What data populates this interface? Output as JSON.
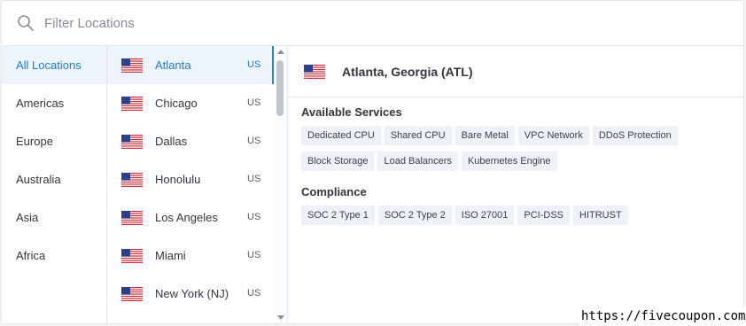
{
  "search": {
    "placeholder": "Filter Locations",
    "value": ""
  },
  "regions": [
    {
      "label": "All Locations",
      "active": true
    },
    {
      "label": "Americas"
    },
    {
      "label": "Europe"
    },
    {
      "label": "Australia"
    },
    {
      "label": "Asia"
    },
    {
      "label": "Africa"
    }
  ],
  "cities": [
    {
      "name": "Atlanta",
      "country": "US",
      "flag": "us-flag-icon",
      "active": true
    },
    {
      "name": "Chicago",
      "country": "US",
      "flag": "us-flag-icon"
    },
    {
      "name": "Dallas",
      "country": "US",
      "flag": "us-flag-icon"
    },
    {
      "name": "Honolulu",
      "country": "US",
      "flag": "us-flag-icon"
    },
    {
      "name": "Los Angeles",
      "country": "US",
      "flag": "us-flag-icon"
    },
    {
      "name": "Miami",
      "country": "US",
      "flag": "us-flag-icon"
    },
    {
      "name": "New York (NJ)",
      "country": "US",
      "flag": "us-flag-icon"
    }
  ],
  "detail": {
    "title": "Atlanta, Georgia (ATL)",
    "flag": "us-flag-icon",
    "services_title": "Available Services",
    "services": [
      "Dedicated CPU",
      "Shared CPU",
      "Bare Metal",
      "VPC Network",
      "DDoS Protection",
      "Block Storage",
      "Load Balancers",
      "Kubernetes Engine"
    ],
    "compliance_title": "Compliance",
    "compliance": [
      "SOC 2 Type 1",
      "SOC 2 Type 2",
      "ISO 27001",
      "PCI-DSS",
      "HITRUST"
    ]
  },
  "watermark": "https://fivecoupon.com",
  "colors": {
    "accent": "#1e7bd6",
    "active_bg": "#eef4fb",
    "tag_bg": "#eef2f7",
    "border": "#e3e6ea"
  }
}
